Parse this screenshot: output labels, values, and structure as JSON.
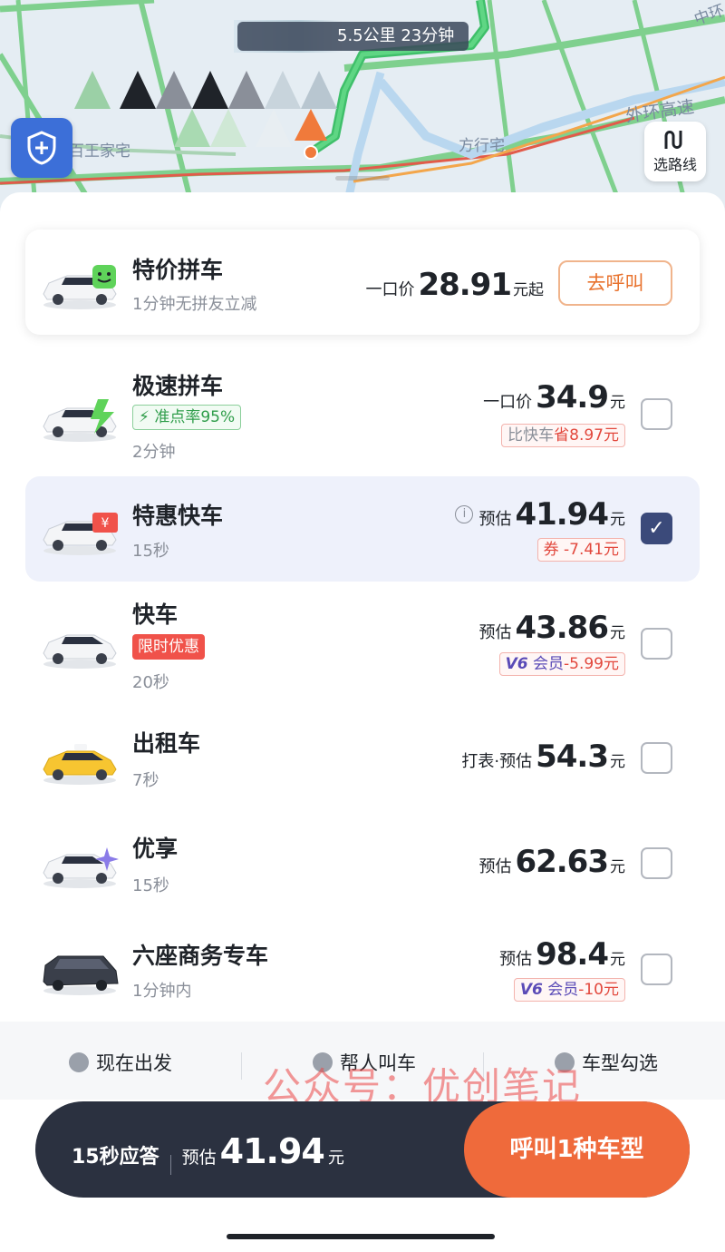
{
  "map": {
    "route_info": "5.5公里 23分钟",
    "labels": [
      "百王家宅",
      "方行宅",
      "外环高速",
      "中环"
    ],
    "route_select_label": "选路线",
    "safety_icon": "shield-plus-icon",
    "route_icon": "route-icon"
  },
  "featured": {
    "name": "特价拼车",
    "sub": "1分钟无拼友立减",
    "price_prefix": "一口价",
    "price": "28.91",
    "price_unit": "元起",
    "call_label": "去呼叫"
  },
  "options": [
    {
      "name": "极速拼车",
      "tag": "准点率95%",
      "tag_type": "green",
      "sub": "2分钟",
      "price_prefix": "一口价",
      "price": "34.9",
      "price_unit": "元",
      "disc_a": "比快车",
      "disc_b": "省8.97元",
      "checked": false
    },
    {
      "name": "特惠快车",
      "sub": "15秒",
      "price_prefix": "预估",
      "price": "41.94",
      "price_unit": "元",
      "disc_a": "券",
      "disc_b": "-7.41元",
      "checked": true
    },
    {
      "name": "快车",
      "tag": "限时优惠",
      "tag_type": "red",
      "sub": "20秒",
      "price_prefix": "预估",
      "price": "43.86",
      "price_unit": "元",
      "disc_v6": "V6",
      "disc_a": "会员",
      "disc_b": "-5.99元",
      "checked": false
    },
    {
      "name": "出租车",
      "sub": "7秒",
      "price_prefix": "打表·预估",
      "price": "54.3",
      "price_unit": "元",
      "checked": false
    },
    {
      "name": "优享",
      "sub": "15秒",
      "price_prefix": "预估",
      "price": "62.63",
      "price_unit": "元",
      "checked": false
    },
    {
      "name": "六座商务专车",
      "sub": "1分钟内",
      "price_prefix": "预估",
      "price": "98.4",
      "price_unit": "元",
      "disc_v6": "V6",
      "disc_a": "会员",
      "disc_b": "-10元",
      "checked": false
    }
  ],
  "option_bar": {
    "depart": "现在出发",
    "help_call": "帮人叫车",
    "car_select": "车型勾选"
  },
  "watermark": "公众号：优创笔记",
  "bottom": {
    "response": "15秒应答",
    "price_prefix": "预估",
    "price": "41.94",
    "price_unit": "元",
    "call_label": "呼叫1种车型"
  },
  "colors": {
    "accent": "#ef6a3b",
    "dark_bar": "#2b3140",
    "check": "#3b4a7a",
    "safety": "#3c6fd8"
  }
}
